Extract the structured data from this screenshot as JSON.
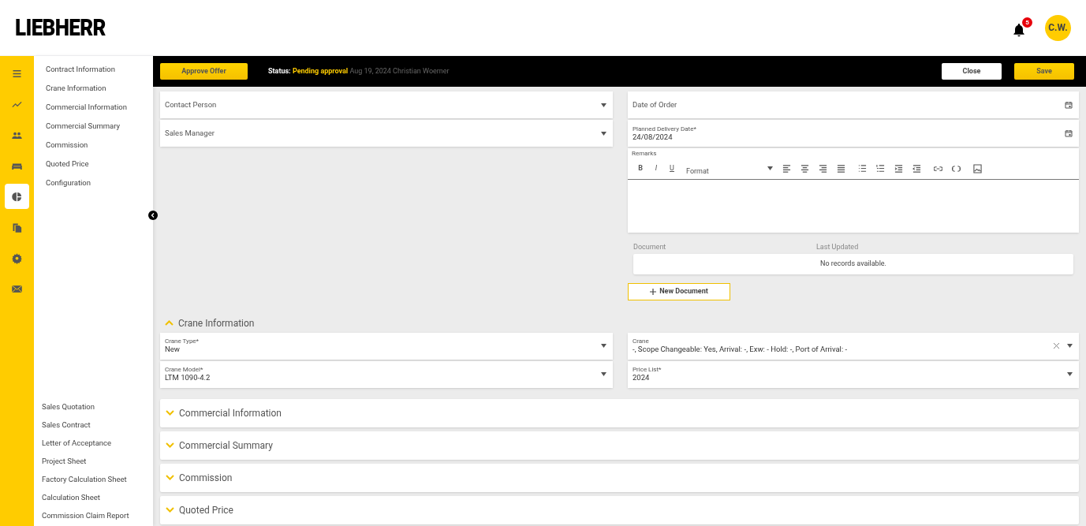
{
  "header": {
    "logo": "LIEBHERR",
    "notification_count": "5",
    "avatar": "C.W."
  },
  "rail": [
    {
      "kind": "menu",
      "selected": false
    },
    {
      "kind": "trend",
      "selected": false
    },
    {
      "kind": "people",
      "selected": false
    },
    {
      "kind": "sofa",
      "selected": false
    },
    {
      "kind": "pie",
      "selected": true
    },
    {
      "kind": "copy",
      "selected": false
    },
    {
      "kind": "gear",
      "selected": false
    },
    {
      "kind": "mail",
      "selected": false
    }
  ],
  "section_nav": [
    "Contract Information",
    "Crane Information",
    "Commercial Information",
    "Commercial Summary",
    "Commission",
    "Quoted Price",
    "Configuration"
  ],
  "document_links": [
    "Sales Quotation",
    "Sales Contract",
    "Letter of Acceptance",
    "Project Sheet",
    "Factory Calculation Sheet",
    "Calculation Sheet",
    "Commission Claim Report"
  ],
  "action_bar": {
    "approve": "Approve Offer",
    "status_label": "Status:",
    "status_value": "Pending approval",
    "status_meta": "Aug 19, 2024 Christian Woerner",
    "buttons": [
      {
        "label": "Close",
        "kind": "secondary"
      },
      {
        "label": "Save",
        "kind": "primary"
      }
    ]
  },
  "contract_left": [
    {
      "placeholder": "Contact Person",
      "kind": "select"
    },
    {
      "placeholder": "Sales Manager",
      "kind": "select"
    }
  ],
  "contract_right": [
    {
      "placeholder": "Date of Order",
      "kind": "date"
    },
    {
      "label": "Planned Delivery Date*",
      "value": "24/08/2024",
      "kind": "date"
    }
  ],
  "remarks": {
    "label": "Remarks",
    "toolbar_text": [
      "B",
      "I",
      "U"
    ],
    "format": "Format"
  },
  "documents": {
    "columns": [
      "Document",
      "Last Updated"
    ],
    "empty": "No records available.",
    "new_button": "New Document"
  },
  "crane_section": {
    "title": "Crane Information",
    "expanded": true,
    "left": [
      {
        "label": "Crane Type*",
        "value": "New",
        "kind": "select"
      },
      {
        "label": "Crane Model*",
        "value": "LTM 1090-4.2",
        "kind": "select"
      }
    ],
    "right": [
      {
        "label": "Crane",
        "value": "-, Scope Changeable: Yes, Arrival: -, Exw: - Hold: -, Port of  Arrival: -",
        "kind": "select",
        "clearable": true
      },
      {
        "label": "Price List*",
        "value": "2024",
        "kind": "select"
      }
    ]
  },
  "sections": [
    {
      "title": "Commercial Information",
      "expanded": false
    },
    {
      "title": "Commercial Summary",
      "expanded": false
    },
    {
      "title": "Commission",
      "expanded": false
    },
    {
      "title": "Quoted Price",
      "expanded": false
    }
  ]
}
